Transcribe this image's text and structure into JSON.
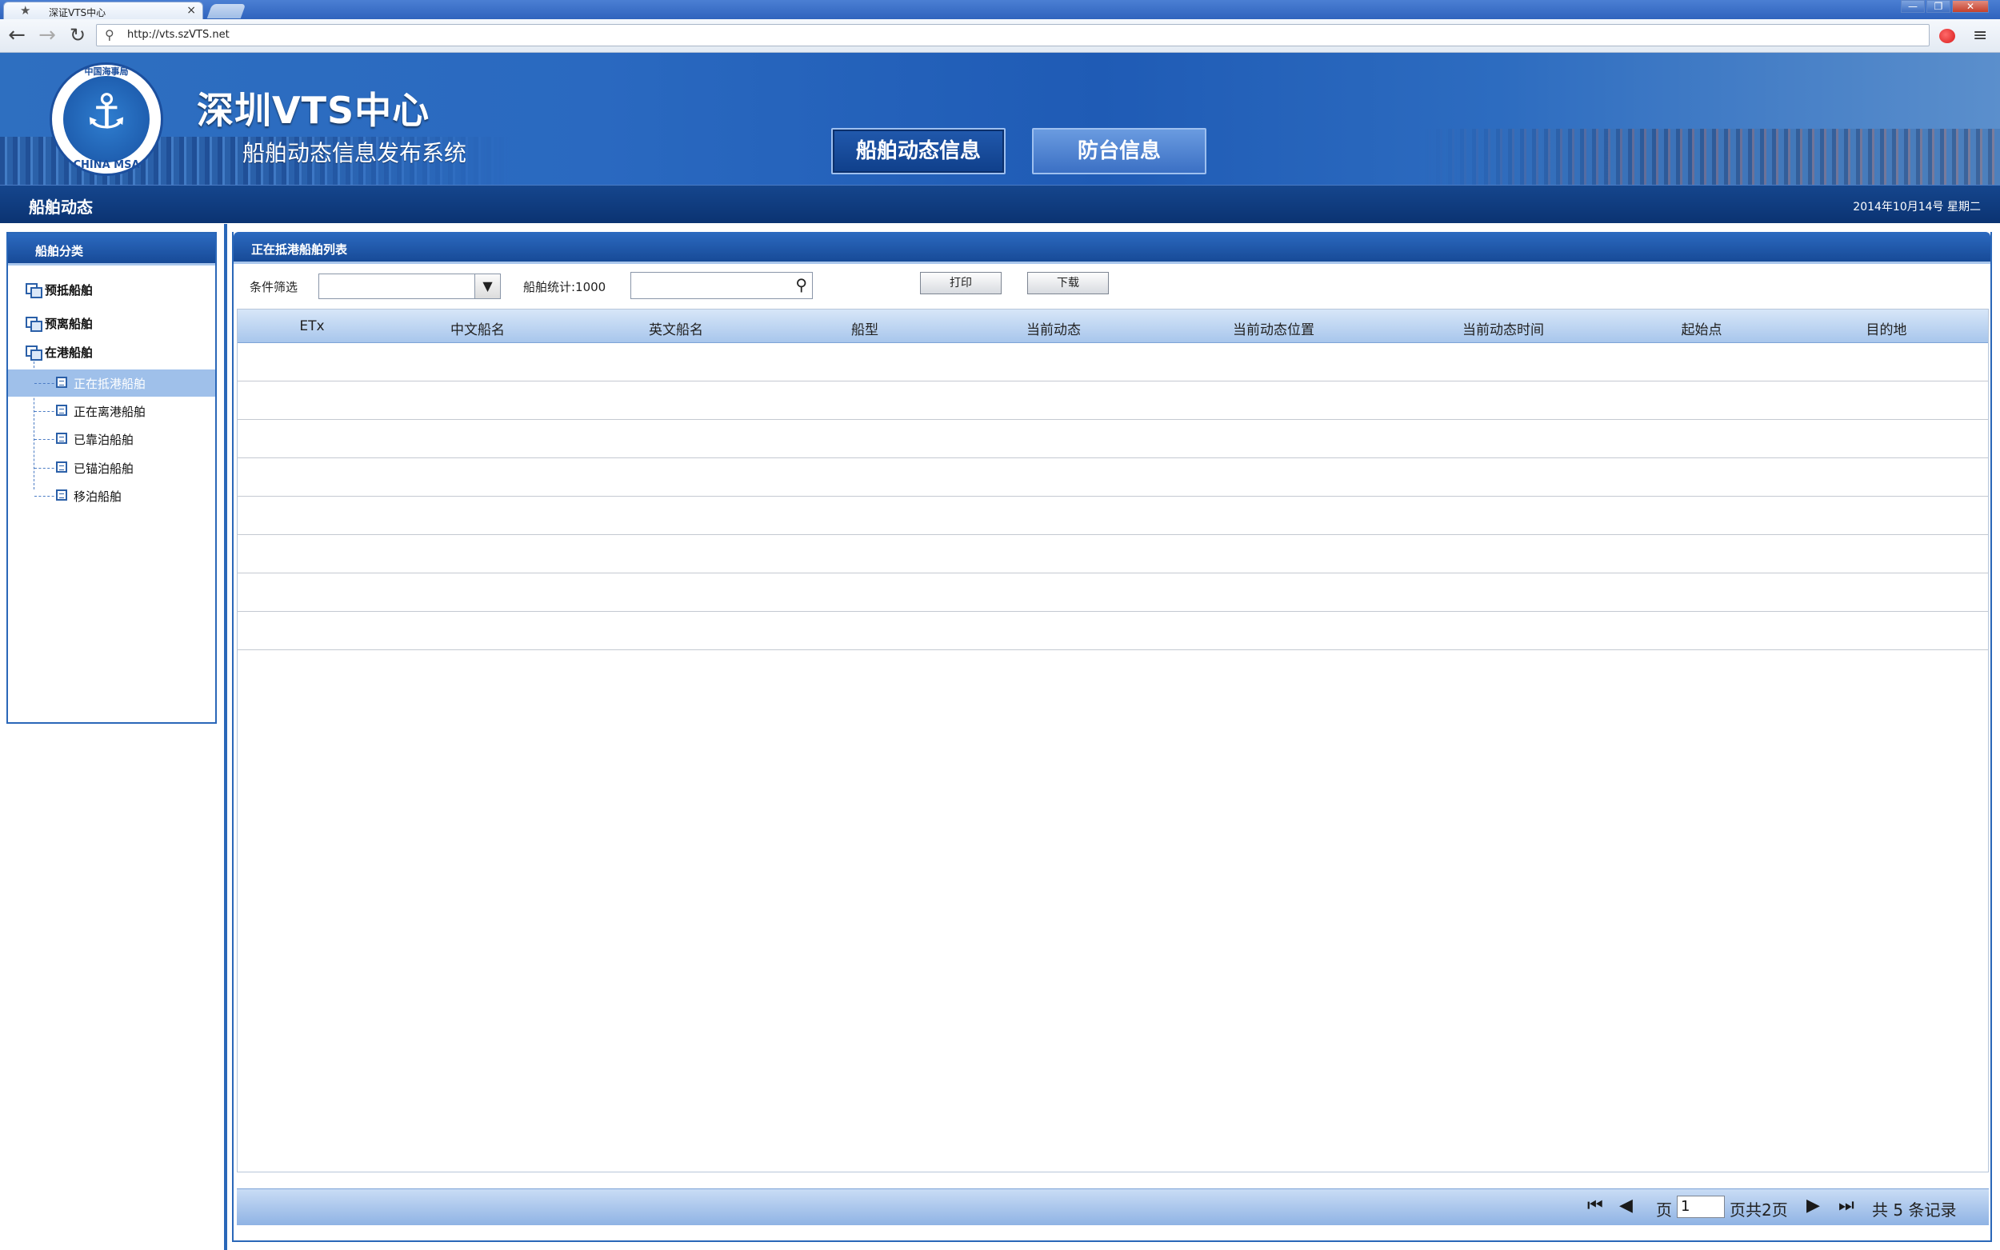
{
  "browser": {
    "tab_title": "深证VTS中心",
    "tab_close": "×",
    "url": "http://vts.szVTS.net",
    "window_buttons": {
      "minimize": "—",
      "maximize": "❐",
      "close": "✕"
    }
  },
  "header": {
    "logo": {
      "text_top": "中国海事局",
      "text_bottom": "CHINA MSA",
      "icon": "anchor-icon"
    },
    "title": "深圳VTS中心",
    "subtitle": "船舶动态信息发布系统",
    "tabs": [
      {
        "label": "船舶动态信息",
        "active": true
      },
      {
        "label": "防台信息",
        "active": false
      }
    ]
  },
  "subnav": {
    "section_title": "船舶动态",
    "date": "2014年10月14号 星期二"
  },
  "sidebar": {
    "title": "船舶分类",
    "groups": [
      {
        "label": "预抵船舶"
      },
      {
        "label": "预离船舶"
      },
      {
        "label": "在港船舶"
      }
    ],
    "children": [
      {
        "label": "正在抵港船舶",
        "selected": true
      },
      {
        "label": "正在离港船舶",
        "selected": false
      },
      {
        "label": "已靠泊船舶",
        "selected": false
      },
      {
        "label": "已锚泊船舶",
        "selected": false
      },
      {
        "label": "移泊船舶",
        "selected": false
      }
    ]
  },
  "main": {
    "title": "正在抵港船舶列表",
    "filter_label": "条件筛选",
    "filter_value": "",
    "count_label": "船舶统计:1000",
    "search_value": "",
    "print_label": "打印",
    "download_label": "下载",
    "columns": [
      "ETx",
      "中文船名",
      "英文船名",
      "船型",
      "当前动态",
      "当前动态位置",
      "当前动态时间",
      "起始点",
      "目的地"
    ],
    "rows": [
      [],
      [],
      [],
      [],
      [],
      [],
      [],
      []
    ]
  },
  "pager": {
    "page_label": "页",
    "current_page": "1",
    "total_label": "页共2页",
    "records_label": "共 5 条记录"
  },
  "colors": {
    "brand_blue": "#1f5bb5",
    "dark_blue": "#0b3372",
    "selected_row": "#9fc0ea",
    "header_grad_top": "#d7e6f8"
  }
}
